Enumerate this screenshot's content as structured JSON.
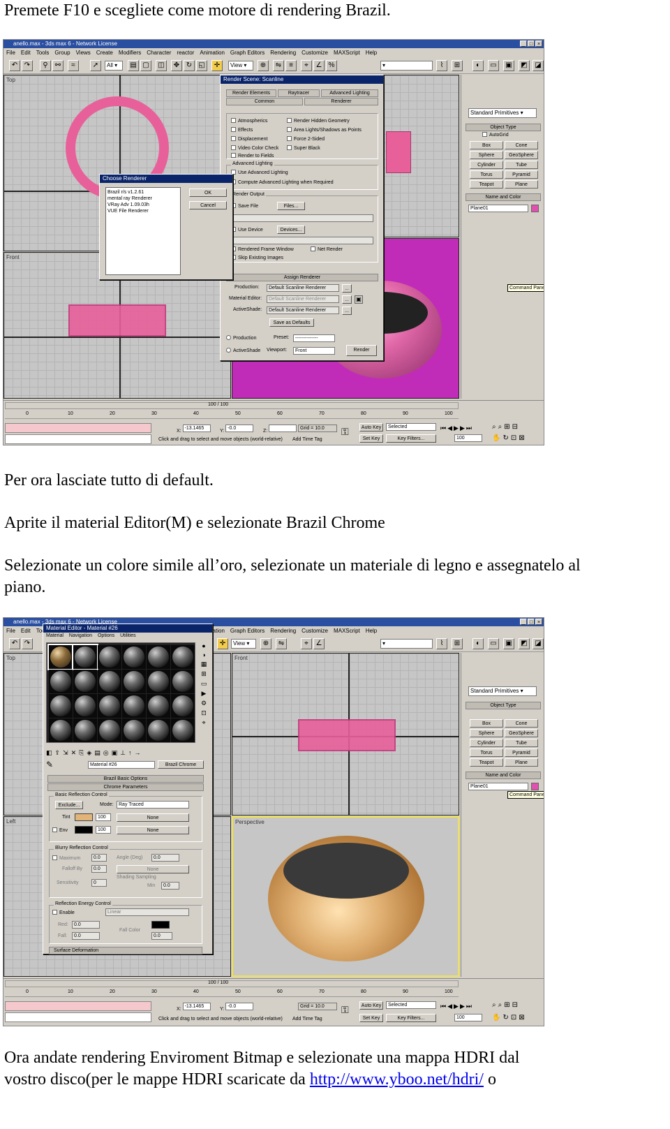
{
  "paragraphs": {
    "p1": "Premete F10 e scegliete come motore di rendering Brazil.",
    "p2": "Per ora lasciate tutto di default.",
    "p3": "Aprite il material Editor(M) e selezionate Brazil Chrome",
    "p4_line1": "Selezionate un colore simile all’oro, selezionate un materiale di legno e assegnatelo al",
    "p4_line2": "piano.",
    "p5_line1": "Ora andate rendering      Enviroment      Bitmap e selezionate una mappa HDRI dal",
    "p5_line2_prefix": "vostro disco(per le mappe HDRI scaricate da ",
    "p5_link": "http://www.yboo.net/hdri/",
    "p5_line2_suffix": " o"
  },
  "screenshot1": {
    "title": "anello.max - 3ds max 6 - Network License",
    "menus": [
      "File",
      "Edit",
      "Tools",
      "Group",
      "Views",
      "Create",
      "Modifiers",
      "Character",
      "reactor",
      "Animation",
      "Graph Editors",
      "Rendering",
      "Customize",
      "MAXScript",
      "Help"
    ],
    "view_select": "View",
    "render_dialog": {
      "title": "Render Scene: Scanline",
      "tabs": [
        "Render Elements",
        "Raytracer",
        "Advanced Lighting",
        "Common",
        "Renderer"
      ],
      "options": [
        "Atmospherics",
        "Render Hidden Geometry",
        "Effects",
        "Area Lights/Shadows as Points",
        "Displacement",
        "Force 2-Sided",
        "Video Color Check",
        "Super Black",
        "Render to Fields"
      ],
      "adv_lighting_group": "Advanced Lighting",
      "adv_use": "Use Advanced Lighting",
      "adv_compute": "Compute Advanced Lighting when Required",
      "render_output_group": "Render Output",
      "save_file": "Save File",
      "files_btn": "Files...",
      "use_device": "Use Device",
      "devices_btn": "Devices...",
      "rendered_frame": "Rendered Frame Window",
      "net_render": "Net Render",
      "skip_existing": "Skip Existing Images",
      "assign_renderer": "Assign Renderer",
      "production_label": "Production:",
      "production_value": "Default Scanline Renderer",
      "material_editor_label": "Material Editor:",
      "material_editor_value": "Default Scanline Renderer",
      "activeshade_label": "ActiveShade:",
      "activeshade_value": "Default Scanline Renderer",
      "save_defaults": "Save as Defaults",
      "mode_production": "Production",
      "mode_activeshade": "ActiveShade",
      "preset_label": "Preset:",
      "preset_value": "--------------",
      "viewport_label": "Viewport:",
      "viewport_value": "Front",
      "render_btn": "Render"
    },
    "choose_renderer": {
      "title": "Choose Renderer",
      "items": [
        "Brazil r/s v1.2.61",
        "mental ray Renderer",
        "VRay Adv 1.09.03h",
        "VUE File Renderer"
      ],
      "ok": "OK",
      "cancel": "Cancel"
    },
    "viewports": [
      "Top",
      "Front",
      "Left",
      "Perspective"
    ],
    "command_panel": {
      "dropdown": "Standard Primitives",
      "object_type": "Object Type",
      "autogrid": "AutoGrid",
      "buttons": [
        "Box",
        "Cone",
        "Sphere",
        "GeoSphere",
        "Cylinder",
        "Tube",
        "Torus",
        "Pyramid",
        "Teapot",
        "Plane"
      ],
      "name_color": "Name and Color",
      "name_value": "Plane01",
      "tooltip": "Command Panel"
    },
    "timeline": {
      "counter": "100 / 100",
      "ticks": [
        "0",
        "10",
        "20",
        "30",
        "40",
        "50",
        "60",
        "70",
        "80",
        "90",
        "100"
      ],
      "x_label": "X:",
      "x_value": "-13.1465",
      "y_label": "Y:",
      "y_value": "-0.0",
      "z_label": "Z:",
      "grid": "Grid = 10.0",
      "status": "Click and drag to select and move objects (world-relative)",
      "add_time_tag": "Add Time Tag",
      "auto_key": "Auto Key",
      "selected": "Selected",
      "set_key": "Set Key",
      "key_filters": "Key Filters...",
      "frame": "100"
    },
    "colors": {
      "torus": "#e8609a",
      "bowl": "#e060a0",
      "persp_bg": "#c02cb8"
    }
  },
  "screenshot2": {
    "title": "anello.max - 3ds max 6 - Network License",
    "material_editor": {
      "title": "Material Editor - Material #26",
      "menus": [
        "Material",
        "Navigation",
        "Options",
        "Utilities"
      ],
      "mat_name": "Material #26",
      "mat_type": "Brazil Chrome",
      "rollouts": [
        "Brazil Basic Options",
        "Chrome Parameters"
      ],
      "basic_reflection": "Basic Reflection Control",
      "exclude_btn": "Exclude...",
      "mode_label": "Mode:",
      "mode_value": "Ray Traced",
      "tint_label": "Tint",
      "tint_value": "100",
      "none1": "None",
      "env_label": "Env",
      "env_value": "100",
      "none2": "None",
      "blurry_group": "Blurry Reflection Control",
      "maximum_label": "Maximum",
      "maximum_value": "0.0",
      "angle_label": "Angle (Deg)",
      "angle_value": "0.0",
      "none3": "None",
      "falloff_label": "Falloff By",
      "falloff_value": "0.0",
      "none4": "None",
      "sensitivity_label": "Sensitivity",
      "sensitivity_value": "0",
      "shading_sampling": "Shading Sampling",
      "min_label": "Min",
      "min_value": "0.0",
      "reflection_group": "Reflection Energy Control",
      "enable_label": "Enable",
      "linear_value": "Linear",
      "red_label": "Red:",
      "red_value": "0.0",
      "fall_label": "Fall:",
      "fall_value": "0.0",
      "fall_color_label": "Fall Color",
      "value_field": "0.0",
      "surface_def": "Surface Deformation"
    },
    "gold_color": "#e2b47a",
    "tooltip": "Command Panel",
    "name_value": "Plane01",
    "ring_color": "#d8a764"
  }
}
